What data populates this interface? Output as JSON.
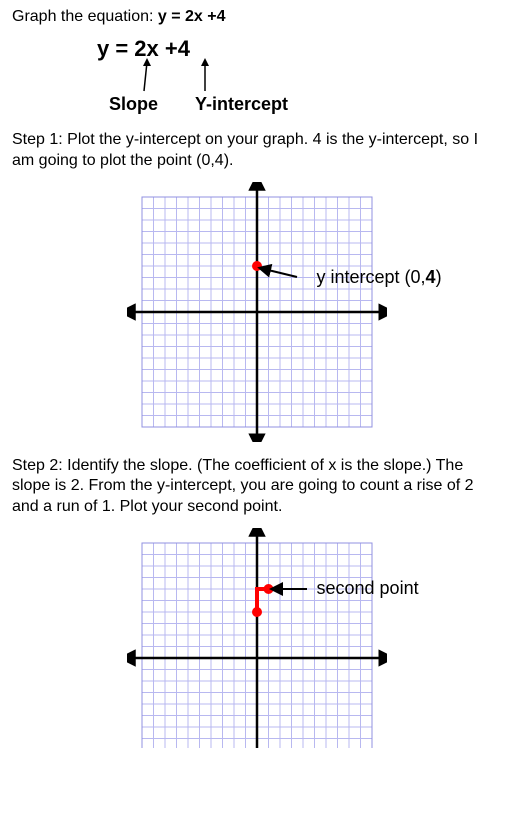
{
  "title_prefix": "Graph the equation: ",
  "title_equation": "y = 2x +4",
  "equation_display": "y = 2x +4",
  "arrow_labels": {
    "slope": "Slope",
    "yintercept": "Y-intercept"
  },
  "step1": "Step 1:  Plot the y-intercept on your graph.  4 is the y-intercept, so I am going to plot the point (0,4).",
  "step2": "Step 2:  Identify the slope.  (The coefficient of x is the slope.)  The slope is 2.  From the y-intercept, you are going to count a rise of 2 and a run of 1.  Plot your second point.",
  "graph1_annotation_prefix": "y intercept (0,",
  "graph1_annotation_bold": "4",
  "graph1_annotation_suffix": ")",
  "graph2_annotation": "second point",
  "chart_data": [
    {
      "type": "scatter",
      "title": "",
      "xlabel": "",
      "ylabel": "",
      "xlim": [
        -10,
        10
      ],
      "ylim": [
        -10,
        10
      ],
      "grid": true,
      "points": [
        {
          "x": 0,
          "y": 4,
          "label": "y intercept (0,4)",
          "color": "#ff0000"
        }
      ]
    },
    {
      "type": "scatter",
      "title": "",
      "xlabel": "",
      "ylabel": "",
      "xlim": [
        -10,
        10
      ],
      "ylim": [
        -10,
        10
      ],
      "grid": true,
      "points": [
        {
          "x": 0,
          "y": 4,
          "label": "",
          "color": "#ff0000"
        },
        {
          "x": 1,
          "y": 6,
          "label": "second point",
          "color": "#ff0000"
        }
      ],
      "segments": [
        {
          "from": [
            0,
            4
          ],
          "to": [
            0,
            6
          ],
          "color": "#ff0000",
          "meaning": "rise 2"
        },
        {
          "from": [
            0,
            6
          ],
          "to": [
            1,
            6
          ],
          "color": "#ff0000",
          "meaning": "run 1"
        }
      ]
    }
  ]
}
